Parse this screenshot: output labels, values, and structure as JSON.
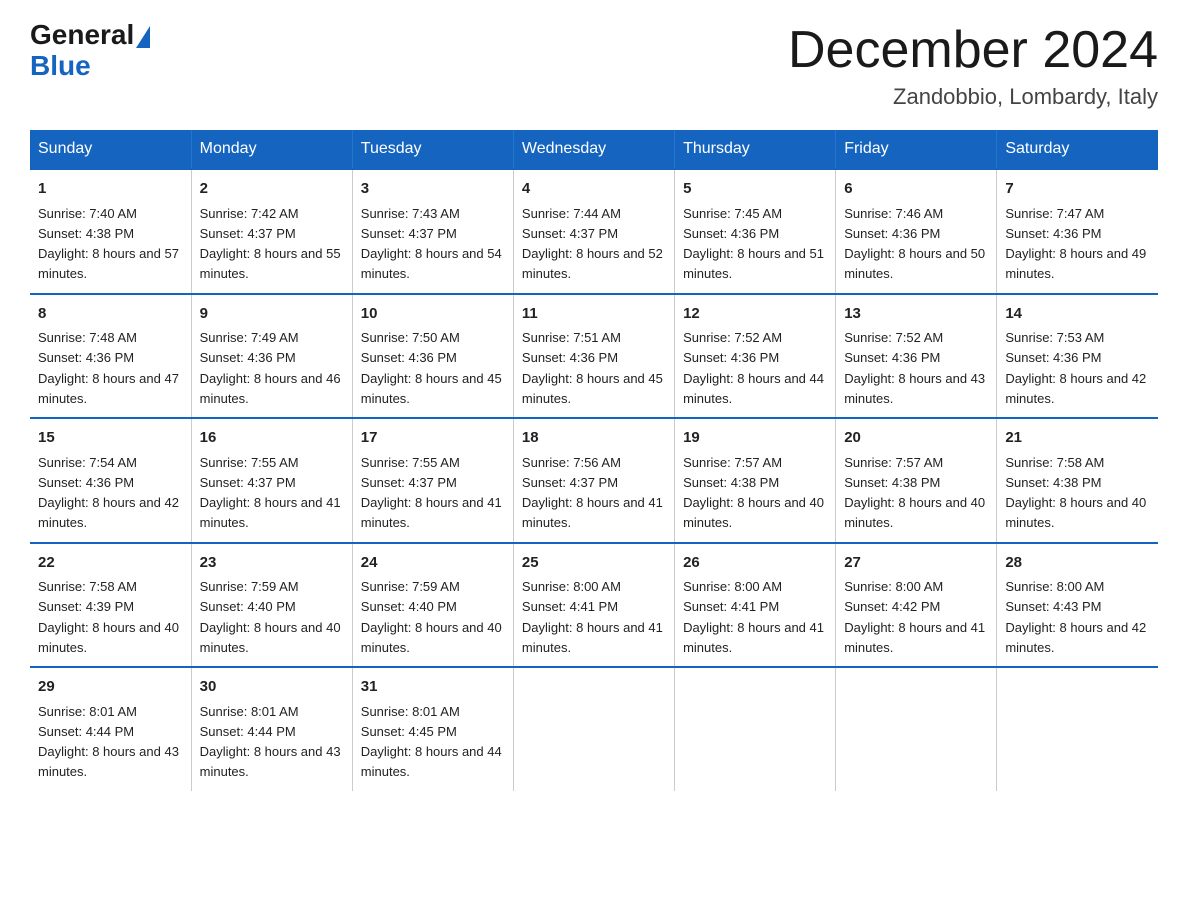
{
  "header": {
    "logo_general": "General",
    "logo_blue": "Blue",
    "month_title": "December 2024",
    "location": "Zandobbio, Lombardy, Italy"
  },
  "days_of_week": [
    "Sunday",
    "Monday",
    "Tuesday",
    "Wednesday",
    "Thursday",
    "Friday",
    "Saturday"
  ],
  "weeks": [
    [
      {
        "day": "1",
        "sunrise": "7:40 AM",
        "sunset": "4:38 PM",
        "daylight": "8 hours and 57 minutes."
      },
      {
        "day": "2",
        "sunrise": "7:42 AM",
        "sunset": "4:37 PM",
        "daylight": "8 hours and 55 minutes."
      },
      {
        "day": "3",
        "sunrise": "7:43 AM",
        "sunset": "4:37 PM",
        "daylight": "8 hours and 54 minutes."
      },
      {
        "day": "4",
        "sunrise": "7:44 AM",
        "sunset": "4:37 PM",
        "daylight": "8 hours and 52 minutes."
      },
      {
        "day": "5",
        "sunrise": "7:45 AM",
        "sunset": "4:36 PM",
        "daylight": "8 hours and 51 minutes."
      },
      {
        "day": "6",
        "sunrise": "7:46 AM",
        "sunset": "4:36 PM",
        "daylight": "8 hours and 50 minutes."
      },
      {
        "day": "7",
        "sunrise": "7:47 AM",
        "sunset": "4:36 PM",
        "daylight": "8 hours and 49 minutes."
      }
    ],
    [
      {
        "day": "8",
        "sunrise": "7:48 AM",
        "sunset": "4:36 PM",
        "daylight": "8 hours and 47 minutes."
      },
      {
        "day": "9",
        "sunrise": "7:49 AM",
        "sunset": "4:36 PM",
        "daylight": "8 hours and 46 minutes."
      },
      {
        "day": "10",
        "sunrise": "7:50 AM",
        "sunset": "4:36 PM",
        "daylight": "8 hours and 45 minutes."
      },
      {
        "day": "11",
        "sunrise": "7:51 AM",
        "sunset": "4:36 PM",
        "daylight": "8 hours and 45 minutes."
      },
      {
        "day": "12",
        "sunrise": "7:52 AM",
        "sunset": "4:36 PM",
        "daylight": "8 hours and 44 minutes."
      },
      {
        "day": "13",
        "sunrise": "7:52 AM",
        "sunset": "4:36 PM",
        "daylight": "8 hours and 43 minutes."
      },
      {
        "day": "14",
        "sunrise": "7:53 AM",
        "sunset": "4:36 PM",
        "daylight": "8 hours and 42 minutes."
      }
    ],
    [
      {
        "day": "15",
        "sunrise": "7:54 AM",
        "sunset": "4:36 PM",
        "daylight": "8 hours and 42 minutes."
      },
      {
        "day": "16",
        "sunrise": "7:55 AM",
        "sunset": "4:37 PM",
        "daylight": "8 hours and 41 minutes."
      },
      {
        "day": "17",
        "sunrise": "7:55 AM",
        "sunset": "4:37 PM",
        "daylight": "8 hours and 41 minutes."
      },
      {
        "day": "18",
        "sunrise": "7:56 AM",
        "sunset": "4:37 PM",
        "daylight": "8 hours and 41 minutes."
      },
      {
        "day": "19",
        "sunrise": "7:57 AM",
        "sunset": "4:38 PM",
        "daylight": "8 hours and 40 minutes."
      },
      {
        "day": "20",
        "sunrise": "7:57 AM",
        "sunset": "4:38 PM",
        "daylight": "8 hours and 40 minutes."
      },
      {
        "day": "21",
        "sunrise": "7:58 AM",
        "sunset": "4:38 PM",
        "daylight": "8 hours and 40 minutes."
      }
    ],
    [
      {
        "day": "22",
        "sunrise": "7:58 AM",
        "sunset": "4:39 PM",
        "daylight": "8 hours and 40 minutes."
      },
      {
        "day": "23",
        "sunrise": "7:59 AM",
        "sunset": "4:40 PM",
        "daylight": "8 hours and 40 minutes."
      },
      {
        "day": "24",
        "sunrise": "7:59 AM",
        "sunset": "4:40 PM",
        "daylight": "8 hours and 40 minutes."
      },
      {
        "day": "25",
        "sunrise": "8:00 AM",
        "sunset": "4:41 PM",
        "daylight": "8 hours and 41 minutes."
      },
      {
        "day": "26",
        "sunrise": "8:00 AM",
        "sunset": "4:41 PM",
        "daylight": "8 hours and 41 minutes."
      },
      {
        "day": "27",
        "sunrise": "8:00 AM",
        "sunset": "4:42 PM",
        "daylight": "8 hours and 41 minutes."
      },
      {
        "day": "28",
        "sunrise": "8:00 AM",
        "sunset": "4:43 PM",
        "daylight": "8 hours and 42 minutes."
      }
    ],
    [
      {
        "day": "29",
        "sunrise": "8:01 AM",
        "sunset": "4:44 PM",
        "daylight": "8 hours and 43 minutes."
      },
      {
        "day": "30",
        "sunrise": "8:01 AM",
        "sunset": "4:44 PM",
        "daylight": "8 hours and 43 minutes."
      },
      {
        "day": "31",
        "sunrise": "8:01 AM",
        "sunset": "4:45 PM",
        "daylight": "8 hours and 44 minutes."
      },
      null,
      null,
      null,
      null
    ]
  ]
}
